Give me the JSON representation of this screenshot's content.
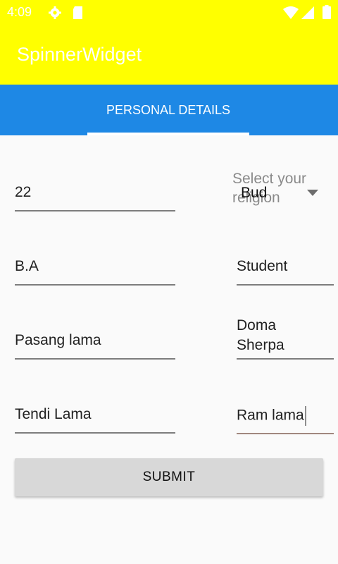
{
  "status_bar": {
    "time": "4:09",
    "icons": [
      "settings-icon",
      "sd-card-icon",
      "wifi-icon",
      "signal-icon",
      "battery-icon"
    ],
    "background": "#ffff00"
  },
  "app_bar": {
    "title": "SpinnerWidget",
    "background": "#ffff00"
  },
  "tabs": [
    {
      "label": "PERSONAL DETAILS",
      "selected": true
    }
  ],
  "tab_bar": {
    "background": "#1e88e5"
  },
  "form": {
    "left": [
      {
        "value": "22"
      },
      {
        "value": "B.A"
      },
      {
        "value": "Pasang lama"
      },
      {
        "value": "Tendi Lama"
      }
    ],
    "religion_spinner": {
      "hint": "Select your religion",
      "selected": "Bud"
    },
    "right": [
      {
        "value": "Student"
      },
      {
        "value_line1": "Doma",
        "value_line2": "Sherpa"
      },
      {
        "value": "Ram lama"
      }
    ],
    "submit_label": "SUBMIT"
  }
}
